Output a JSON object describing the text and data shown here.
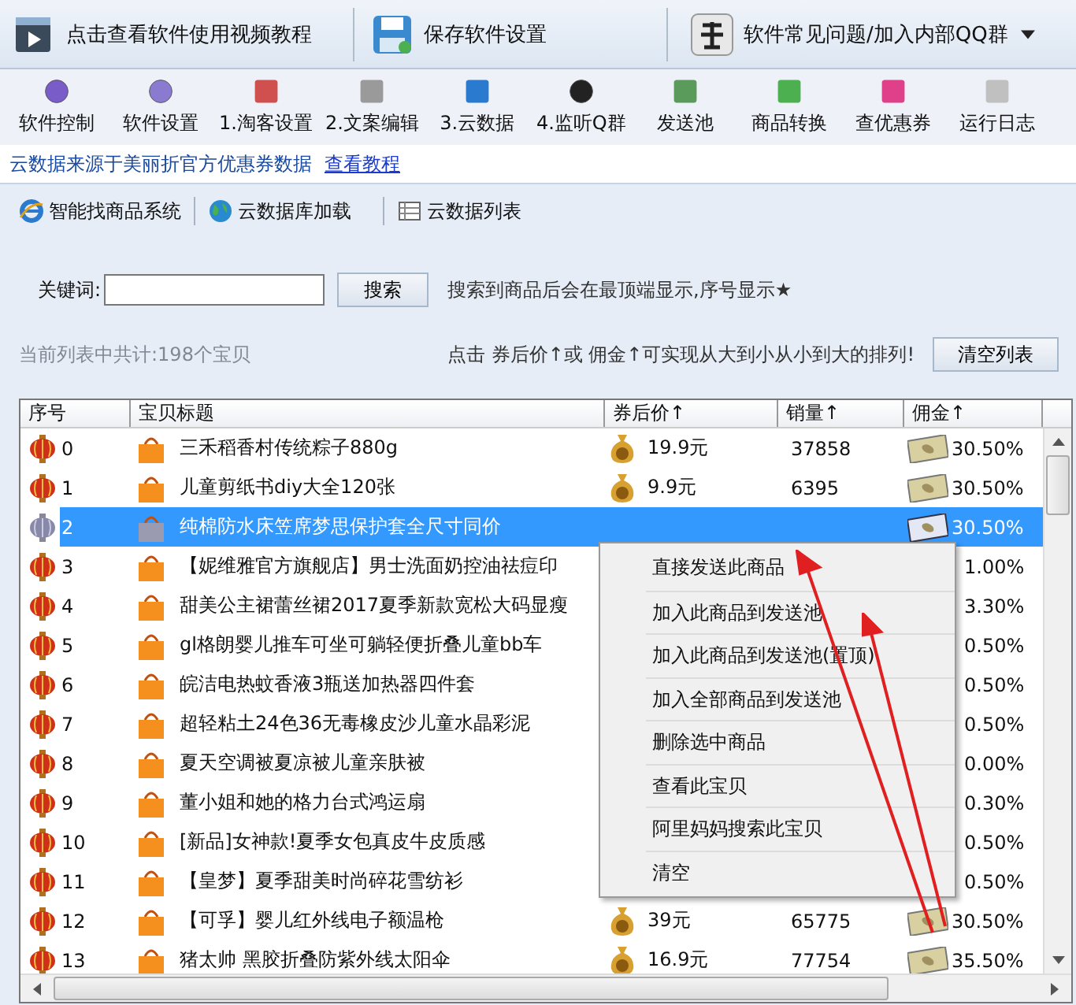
{
  "top_toolbar": [
    {
      "label": "点击查看软件使用视频教程",
      "kind": "video"
    },
    {
      "label": "保存软件设置",
      "kind": "save"
    },
    {
      "label": "软件常见问题/加入内部QQ群",
      "kind": "help"
    }
  ],
  "nav": [
    {
      "label": "软件控制",
      "kind": "play"
    },
    {
      "label": "软件设置",
      "kind": "gear"
    },
    {
      "label": "1.淘客设置",
      "kind": "pencil"
    },
    {
      "label": "2.文案编辑",
      "kind": "scroll"
    },
    {
      "label": "3.云数据",
      "kind": "monitor"
    },
    {
      "label": "4.监听Q群",
      "kind": "penguin"
    },
    {
      "label": "发送池",
      "kind": "db"
    },
    {
      "label": "商品转换",
      "kind": "convert"
    },
    {
      "label": "查优惠券",
      "kind": "coupon"
    },
    {
      "label": "运行日志",
      "kind": "clipboard"
    }
  ],
  "info_bar": {
    "text": "云数据来源于美丽折官方优惠券数据",
    "link": "查看教程"
  },
  "tabs": [
    {
      "label": "智能找商品系统",
      "kind": "ie"
    },
    {
      "label": "云数据库加载",
      "kind": "globe"
    },
    {
      "label": "云数据列表",
      "kind": "table"
    }
  ],
  "search": {
    "label": "关键词:",
    "button": "搜索",
    "hint": "搜索到商品后会在最顶端显示,序号显示★"
  },
  "summary": {
    "count_text": "当前列表中共计:198个宝贝",
    "sort_hint": "点击 券后价↑或 佣金↑可实现从大到小从小到大的排列!",
    "clear_button": "清空列表"
  },
  "table": {
    "columns": [
      "序号",
      "宝贝标题",
      "券后价↑",
      "销量↑",
      "佣金↑"
    ],
    "rows": [
      {
        "index": "0",
        "title": "三禾稻香村传统粽子880g",
        "price": "19.9元",
        "sales": "37858",
        "commission": "30.50%",
        "selected": false
      },
      {
        "index": "1",
        "title": "儿童剪纸书diy大全120张",
        "price": "9.9元",
        "sales": "6395",
        "commission": "30.50%",
        "selected": false
      },
      {
        "index": "2",
        "title": "纯棉防水床笠席梦思保护套全尺寸同价",
        "commission": "30.50%",
        "selected": true
      },
      {
        "index": "3",
        "title": "【妮维雅官方旗舰店】男士洗面奶控油祛痘印",
        "commission": "1.00%",
        "selected": false
      },
      {
        "index": "4",
        "title": "甜美公主裙蕾丝裙2017夏季新款宽松大码显瘦",
        "commission": "3.30%",
        "selected": false
      },
      {
        "index": "5",
        "title": "gl格朗婴儿推车可坐可躺轻便折叠儿童bb车",
        "commission": "0.50%",
        "selected": false
      },
      {
        "index": "6",
        "title": "皖洁电热蚊香液3瓶送加热器四件套",
        "commission": "0.50%",
        "selected": false
      },
      {
        "index": "7",
        "title": "超轻粘土24色36无毒橡皮沙儿童水晶彩泥",
        "commission": "0.50%",
        "selected": false
      },
      {
        "index": "8",
        "title": "夏天空调被夏凉被儿童亲肤被",
        "commission": "0.00%",
        "selected": false
      },
      {
        "index": "9",
        "title": "董小姐和她的格力台式鸿运扇",
        "commission": "0.30%",
        "selected": false
      },
      {
        "index": "10",
        "title": "[新品]女神款!夏季女包真皮牛皮质感",
        "commission": "0.50%",
        "selected": false
      },
      {
        "index": "11",
        "title": "【皇梦】夏季甜美时尚碎花雪纺衫",
        "commission": "0.50%",
        "selected": false
      },
      {
        "index": "12",
        "title": "【可孚】婴儿红外线电子额温枪",
        "price": "39元",
        "sales": "65775",
        "commission": "30.50%",
        "selected": false
      },
      {
        "index": "13",
        "title": "猪太帅 黑胶折叠防紫外线太阳伞",
        "price": "16.9元",
        "sales": "77754",
        "commission": "35.50%",
        "selected": false
      }
    ]
  },
  "context_menu": [
    "直接发送此商品",
    "加入此商品到发送池",
    "加入此商品到发送池(置顶)",
    "加入全部商品到发送池",
    "删除选中商品",
    "查看此宝贝",
    "阿里妈妈搜索此宝贝",
    "清空"
  ]
}
